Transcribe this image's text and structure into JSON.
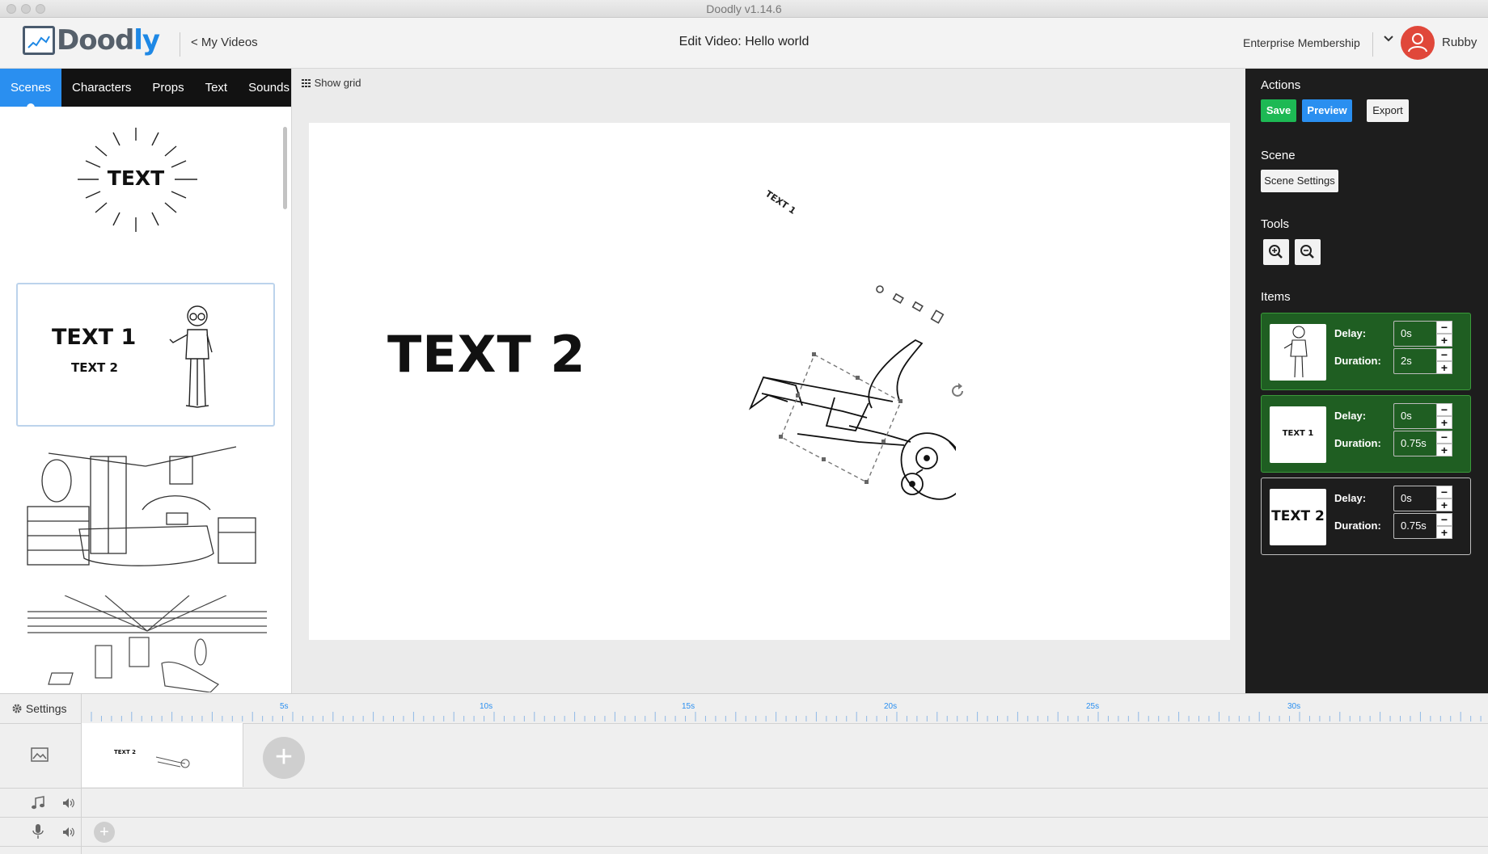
{
  "window": {
    "title": "Doodly v1.14.6"
  },
  "header": {
    "logo_text_a": "Dood",
    "logo_text_b": "ly",
    "back_link": "< My Videos",
    "page_title": "Edit Video: Hello world",
    "membership": "Enterprise Membership",
    "user_name": "Rubby",
    "chevron_icon": "chevron-down-icon",
    "avatar_icon": "user-avatar-icon"
  },
  "left_panel": {
    "tabs": [
      {
        "label": "Scenes",
        "active": true
      },
      {
        "label": "Characters",
        "active": false
      },
      {
        "label": "Props",
        "active": false
      },
      {
        "label": "Text",
        "active": false
      },
      {
        "label": "Sounds",
        "active": false
      }
    ],
    "scenes": [
      {
        "text": "TEXT"
      },
      {
        "text1": "TEXT 1",
        "text2": "TEXT 2"
      },
      {
        "kind": "bedroom"
      },
      {
        "kind": "room perspective"
      }
    ]
  },
  "canvas": {
    "show_grid_label": "Show grid",
    "text_large": "TEXT 2",
    "text_small": "TEXT 1"
  },
  "right_panel": {
    "actions_title": "Actions",
    "save_label": "Save",
    "preview_label": "Preview",
    "export_label": "Export",
    "scene_title": "Scene",
    "scene_settings_label": "Scene Settings",
    "tools_title": "Tools",
    "items_title": "Items",
    "delay_label": "Delay:",
    "duration_label": "Duration:",
    "items": [
      {
        "kind": "character",
        "delay": "0s",
        "duration": "2s"
      },
      {
        "kind": "text",
        "thumb_text": "TEXT 1",
        "delay": "0s",
        "duration": "0.75s"
      },
      {
        "kind": "text",
        "thumb_text": "TEXT 2",
        "delay": "0s",
        "duration": "0.75s"
      }
    ]
  },
  "timeline": {
    "settings_label": "Settings",
    "tick_labels": [
      "5s",
      "10s",
      "15s",
      "20s",
      "25s",
      "30s"
    ],
    "clip_text": "TEXT 2"
  },
  "colors": {
    "accent_blue": "#2a8ff0",
    "save_green": "#1db954",
    "avatar_red": "#e0473a"
  }
}
